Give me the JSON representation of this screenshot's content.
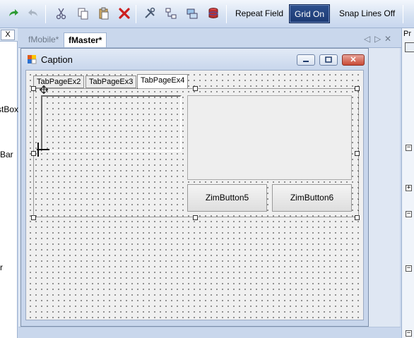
{
  "toolbar": {
    "icons": [
      "redo-icon",
      "undo-icon",
      "cut-icon",
      "copy-icon",
      "paste-icon",
      "delete-icon",
      "tools-icon",
      "hierarchy-icon",
      "network-icon",
      "database-icon"
    ],
    "repeat_field_label": "Repeat Field",
    "grid_on_label": "Grid On",
    "snap_lines_label": "Snap Lines Off"
  },
  "left_panel": {
    "close_label": "X",
    "labels": [
      "stBox",
      "Bar",
      "r"
    ]
  },
  "right_panel": {
    "head_label": "Pr",
    "expanders": [
      "−",
      "+",
      "−",
      "−",
      "−"
    ]
  },
  "doc_tabs": [
    {
      "label": "fMobile*",
      "active": false
    },
    {
      "label": "fMaster*",
      "active": true
    }
  ],
  "doc_nav": {
    "prev": "◁",
    "next": "▷",
    "close": "✕"
  },
  "form": {
    "caption": "Caption",
    "minimize": "—",
    "maximize": "□",
    "close": "✕",
    "tabs": [
      {
        "label": "TabPageEx2",
        "active": false
      },
      {
        "label": "TabPageEx3",
        "active": false
      },
      {
        "label": "TabPageEx4",
        "active": true
      }
    ],
    "buttons": [
      "ZimButton5",
      "ZimButton6"
    ]
  },
  "colors": {
    "toolbar_active": "#1c3a74",
    "delete_red": "#cc1f1f",
    "redo_green": "#2e9b34"
  }
}
